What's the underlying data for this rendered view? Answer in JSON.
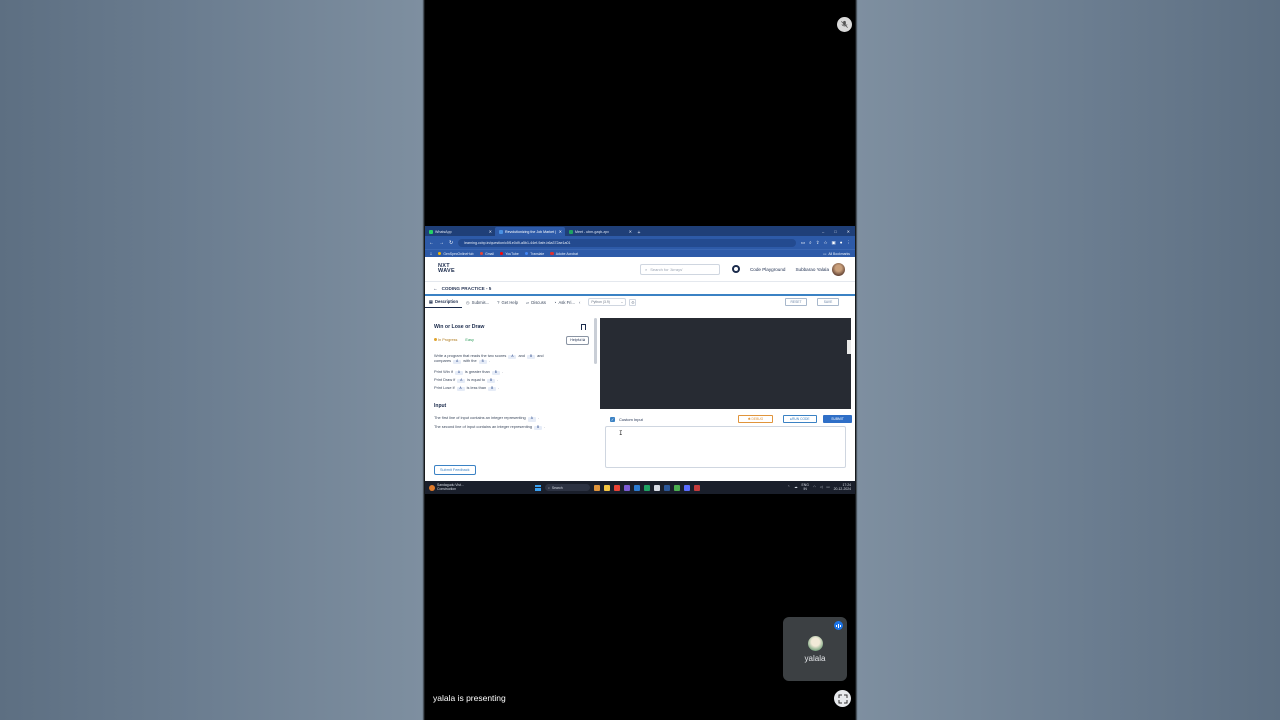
{
  "meeting": {
    "presenter_banner": "yalala is presenting",
    "participant_name": "yalala"
  },
  "browser": {
    "tabs": [
      {
        "label": "WhatsApp",
        "color": "#25d366"
      },
      {
        "label": "Revolutionizing the Job Market |",
        "color": "#4a90e2"
      },
      {
        "label": "Meet - ubm-gzqb-zpx",
        "color": "#1ea362"
      }
    ],
    "url": "learning.ccbp.in/question/c5f1e0d9-a5b1-44ef-9afe-b6a372ae1a01",
    "bookmarks": [
      "GenSpecOnlineHub",
      "Gmail",
      "YouTube",
      "Translate",
      "Adobe Acrobat"
    ],
    "bookmarks_right": "All Bookmarks"
  },
  "app": {
    "logo_line1": "NXT",
    "logo_line2": "WAVE",
    "search_placeholder": "Search for 'Arrays'",
    "code_playground": "Code Playground",
    "user_name": "Subbarao Yalala",
    "breadcrumb": "CODING PRACTICE - 5"
  },
  "toolbar": {
    "tabs": [
      "Description",
      "Submis...",
      "Get Help",
      "Discuss",
      "Ask Fri..."
    ],
    "language": "Python (3.9)",
    "reset": "RESET",
    "save": "SAVE"
  },
  "problem": {
    "title": "Win or Lose or Draw",
    "status": "In Progress",
    "difficulty": "Easy",
    "helpful": "Helpful",
    "desc_prefix": "Write a program that reads the two scores",
    "desc_and": "and",
    "desc_compares": "compares",
    "desc_with": "with the",
    "var_a": "A",
    "var_b": "B",
    "rule1_pre": "Print Win if",
    "rule1_mid": "is greater than",
    "rule2_pre": "Print Draw if",
    "rule2_mid": "is equal to",
    "rule3_pre": "Print Lose if",
    "rule3_mid": "is less than",
    "input_heading": "Input",
    "input_line1": "The first line of input contains an integer representing",
    "input_line2": "The second line of input contains an integer representing",
    "submit_feedback": "Submit Feedback"
  },
  "run_panel": {
    "custom_input_label": "Custom Input",
    "debug": "DEBUG",
    "run_code": "RUN CODE",
    "submit": "SUBMIT",
    "checkbox_checked": true
  },
  "taskbar": {
    "weather_line1": "Sandagudu Vist...",
    "weather_line2": "Construction",
    "search": "Search",
    "lang_line1": "ENG",
    "lang_line2": "IN",
    "time": "17:24",
    "date": "20-12-2024"
  },
  "colors": {
    "accent": "#3b82c4",
    "browser_chrome": "#2d5aa8",
    "editor_bg": "#272b33",
    "debug": "#e0943b",
    "meet_tile": "#3c4043"
  },
  "icons": [
    "mic-off-icon",
    "search-icon",
    "back-arrow-icon",
    "bookmark-icon",
    "expand-icon",
    "speaking-icon"
  ]
}
